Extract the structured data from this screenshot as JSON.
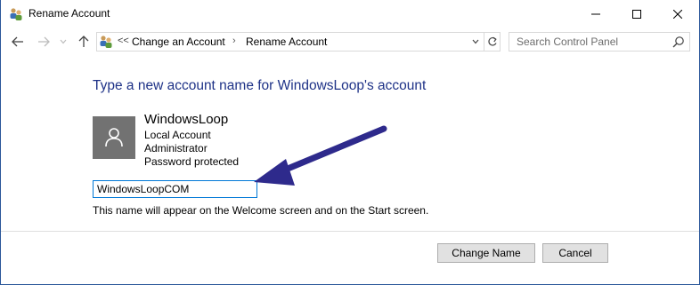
{
  "window": {
    "title": "Rename Account",
    "icon": "user-accounts-icon"
  },
  "nav": {
    "back_icon": "back-arrow-icon",
    "forward_icon": "forward-arrow-icon",
    "recent_icon": "chevron-down-icon",
    "up_icon": "up-arrow-icon"
  },
  "address": {
    "overflow": "<<",
    "crumbs": [
      "Change an Account",
      "Rename Account"
    ]
  },
  "search": {
    "placeholder": "Search Control Panel"
  },
  "content": {
    "heading": "Type a new account name for WindowsLoop's account",
    "account": {
      "name": "WindowsLoop",
      "type": "Local Account",
      "role": "Administrator",
      "protection": "Password protected"
    },
    "new_name_value": "WindowsLoopCOM",
    "hint": "This name will appear on the Welcome screen and on the Start screen."
  },
  "buttons": {
    "change_name": "Change Name",
    "cancel": "Cancel"
  },
  "colors": {
    "heading": "#1e3287",
    "annotation_arrow": "#2e2a8c",
    "input_focus_border": "#0078d7",
    "avatar_bg": "#727272"
  }
}
